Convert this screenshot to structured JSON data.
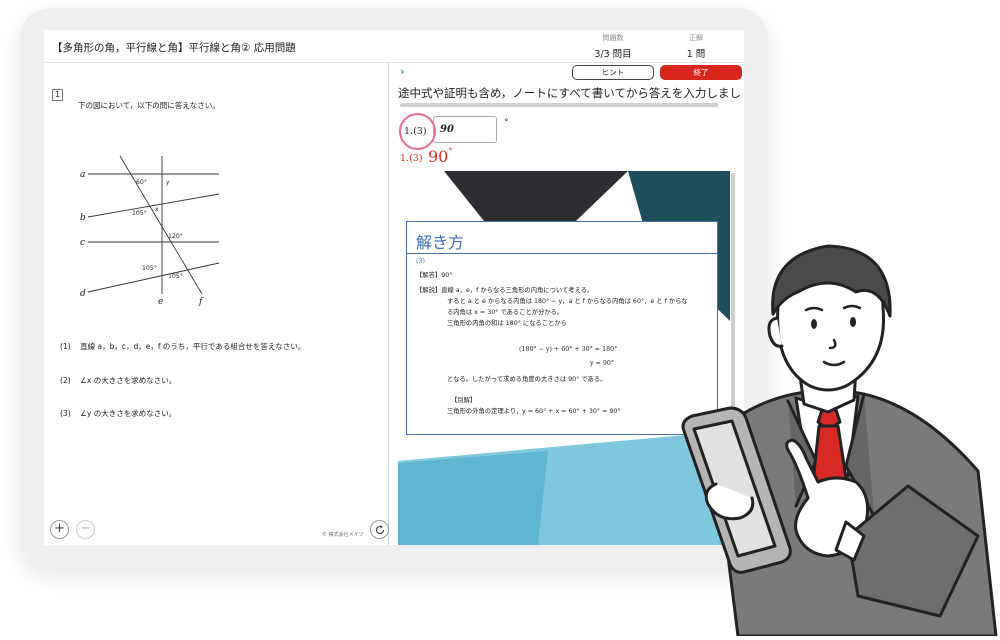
{
  "header": {
    "title": "【多角形の角，平行線と角】平行線と角② 応用問題",
    "question_count_label": "問題数",
    "question_count": "3/3 問目",
    "correct_label": "正解",
    "correct_count": "1 問"
  },
  "problem": {
    "number": "1",
    "lead": "下の図において，以下の問に答えなさい。",
    "figure": {
      "line_labels": [
        "a",
        "b",
        "c",
        "d",
        "e",
        "f"
      ],
      "angle_labels": [
        "60°",
        "y",
        "105°",
        "x",
        "120°",
        "105°",
        "105°"
      ]
    },
    "questions": [
      {
        "num": "(1)",
        "text": "直線 a，b，c，d，e，f のうち，平行である組合せを答えなさい。"
      },
      {
        "num": "(2)",
        "text": "∠x の大きさを求めなさい。"
      },
      {
        "num": "(3)",
        "text": "∠y の大きさを求めなさい。"
      }
    ],
    "zoom_in": "+",
    "zoom_out": "−",
    "company": "© 株式会社メイツ"
  },
  "answer_panel": {
    "hint_button": "ヒント",
    "end_button": "終了",
    "instruction": "途中式や証明も含め，ノートにすべて書いてから答えを入力しましょう。",
    "answer_label": "1.(3)",
    "answer_value": "90",
    "degree": "°",
    "submitted_label": "1.(3)",
    "submitted_value": "90",
    "submitted_degree": "°"
  },
  "explanation": {
    "title": "解き方",
    "part": "(3)",
    "answer_line": "【解答】90°",
    "lines": [
      "【解説】直線 a，e，f からなる三角形の内角について考える。",
      "すると a と e からなる内角は 180° − y，a と f からなる内角は 60°，e と f からな",
      "る内角は x = 30° であることが分かる。",
      "三角形の内角の和は 180° になることから",
      "(180° − y) + 60° + 30°  =  180°",
      "y  =  90°",
      "となる。したがって求める角度の大きさは 90° である。",
      "【別解】",
      "三角形の外角の定理より，y = 60° + x = 60° + 30° = 90°"
    ]
  },
  "colors": {
    "end_button": "#d7261e",
    "answer_red": "#d7261e",
    "focus_ring": "#e66e8e",
    "explanation_blue": "#3d6db5",
    "hint_teal": "#2a9a7a"
  }
}
